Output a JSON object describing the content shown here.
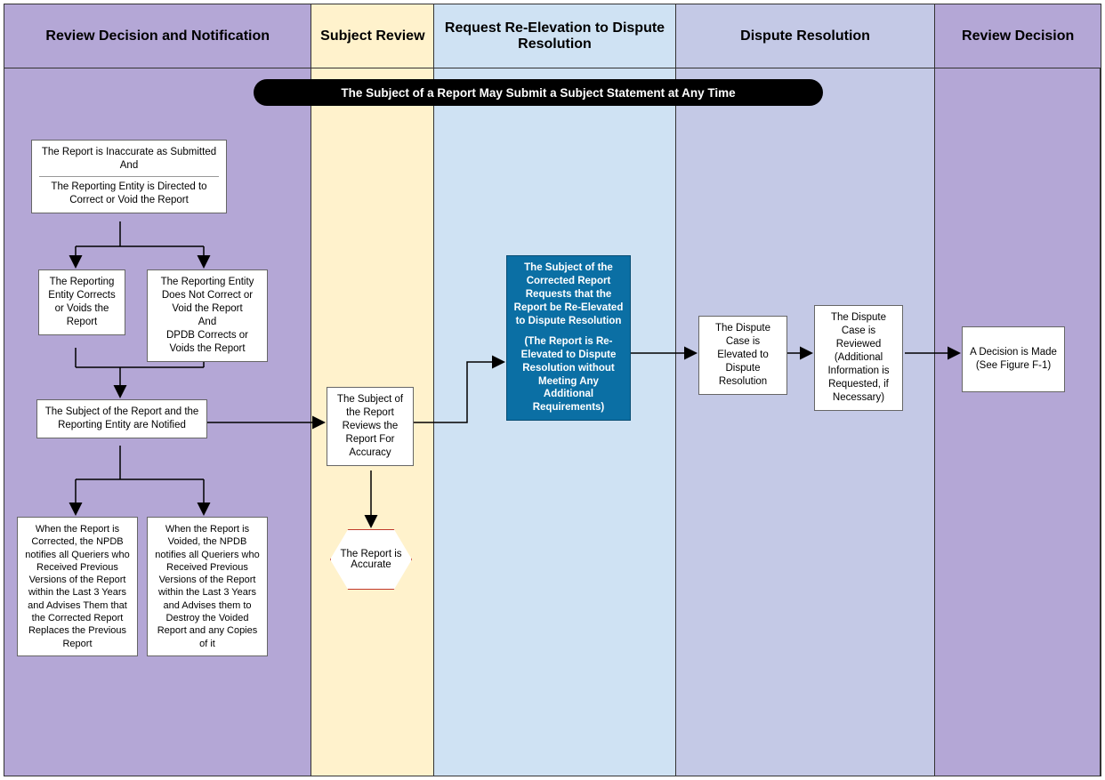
{
  "headers": {
    "c1": "Review Decision and Notification",
    "c2": "Subject Review",
    "c3": "Request Re-Elevation to Dispute Resolution",
    "c4": "Dispute Resolution",
    "c5": "Review Decision"
  },
  "banner": "The Subject of a Report May Submit a Subject Statement at Any Time",
  "col1": {
    "box_top_line1": "The Report is Inaccurate as Submitted",
    "box_top_and1": "And",
    "box_top_line2": "The Reporting Entity is Directed to Correct or Void the Report",
    "box_left": "The Reporting Entity Corrects or Voids the Report",
    "box_right_line1": "The Reporting Entity Does Not Correct or Void the Report",
    "box_right_and": "And",
    "box_right_line2": "DPDB Corrects or Voids the Report",
    "box_notify": "The Subject of the Report and the Reporting Entity are Notified",
    "box_bottom_left": "When the Report is Corrected, the NPDB notifies all Queriers who Received Previous Versions of the Report within the Last 3 Years and Advises Them that the Corrected Report Replaces the Previous Report",
    "box_bottom_right": "When the Report is Voided, the NPDB notifies all Queriers who Received Previous Versions of the Report within the Last 3 Years and Advises them to Destroy the Voided Report and any Copies of it"
  },
  "col2": {
    "box_review": "The Subject of the Report Reviews the Report For Accuracy",
    "hex": "The Report is Accurate"
  },
  "col3": {
    "blue_main": "The Subject of the Corrected Report Requests that the Report be Re-Elevated to Dispute Resolution",
    "blue_sub": "(The Report is Re-Elevated to Dispute Resolution without Meeting Any Additional Requirements)"
  },
  "col4": {
    "box_left": "The Dispute Case is Elevated to Dispute Resolution",
    "box_right": "The Dispute Case is Reviewed (Additional Information is Requested, if Necessary)"
  },
  "col5": {
    "box": "A Decision is Made\n(See Figure F-1)"
  }
}
